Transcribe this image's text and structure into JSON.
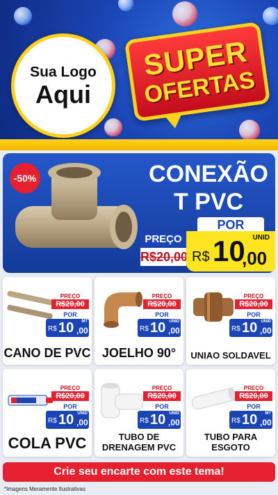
{
  "header": {
    "logo_line1": "Sua Logo",
    "logo_line2": "Aqui",
    "super": "SUPER",
    "ofertas": "OFERTAS"
  },
  "featured": {
    "discount": "-50%",
    "title_line1": "CONEXÃO",
    "title_line2": "T PVC",
    "por_label": "POR",
    "preco_label": "PREÇO",
    "old_currency": "R$",
    "old_int": "20",
    "old_dec": ",00",
    "currency": "R$",
    "price_int": "10",
    "price_dec": ",00",
    "unit": "UNID"
  },
  "products": [
    {
      "name": "CANO DE PVC",
      "preco_label": "PREÇO",
      "old_price": "R$20,00",
      "por_label": "POR",
      "currency": "R$",
      "price_int": "10",
      "price_dec": ",00",
      "unit": "MT"
    },
    {
      "name": "JOELHO 90°",
      "preco_label": "PREÇO",
      "old_price": "R$20,00",
      "por_label": "POR",
      "currency": "R$",
      "price_int": "10",
      "price_dec": ",00",
      "unit": "UNID"
    },
    {
      "name": "UNIAO SOLDAVEL",
      "preco_label": "PREÇO",
      "old_price": "R$20,00",
      "por_label": "POR",
      "currency": "R$",
      "price_int": "10",
      "price_dec": ",00",
      "unit": "UNID"
    },
    {
      "name": "COLA PVC",
      "preco_label": "PREÇO",
      "old_price": "R$20,00",
      "por_label": "POR",
      "currency": "R$",
      "price_int": "10",
      "price_dec": ",00",
      "unit": "UNID"
    },
    {
      "name_line1": "TUBO DE",
      "name_line2": "DRENAGEM PVC",
      "preco_label": "PREÇO",
      "old_price": "R$20,00",
      "por_label": "POR",
      "currency": "R$",
      "price_int": "10",
      "price_dec": ",00",
      "unit": "UNID"
    },
    {
      "name_line1": "TUBO PARA",
      "name_line2": "ESGOTO",
      "preco_label": "PREÇO",
      "old_price": "R$20,00",
      "por_label": "POR",
      "currency": "R$",
      "price_int": "10",
      "price_dec": ",00",
      "unit": "MT"
    }
  ],
  "cta": "Crie seu encarte com este tema!",
  "disclaimer": "*Imagens Meramente Ilustrativas",
  "colors": {
    "brand_blue": "#1b45b5",
    "accent_yellow": "#ffe51f",
    "accent_red": "#e6202e"
  }
}
